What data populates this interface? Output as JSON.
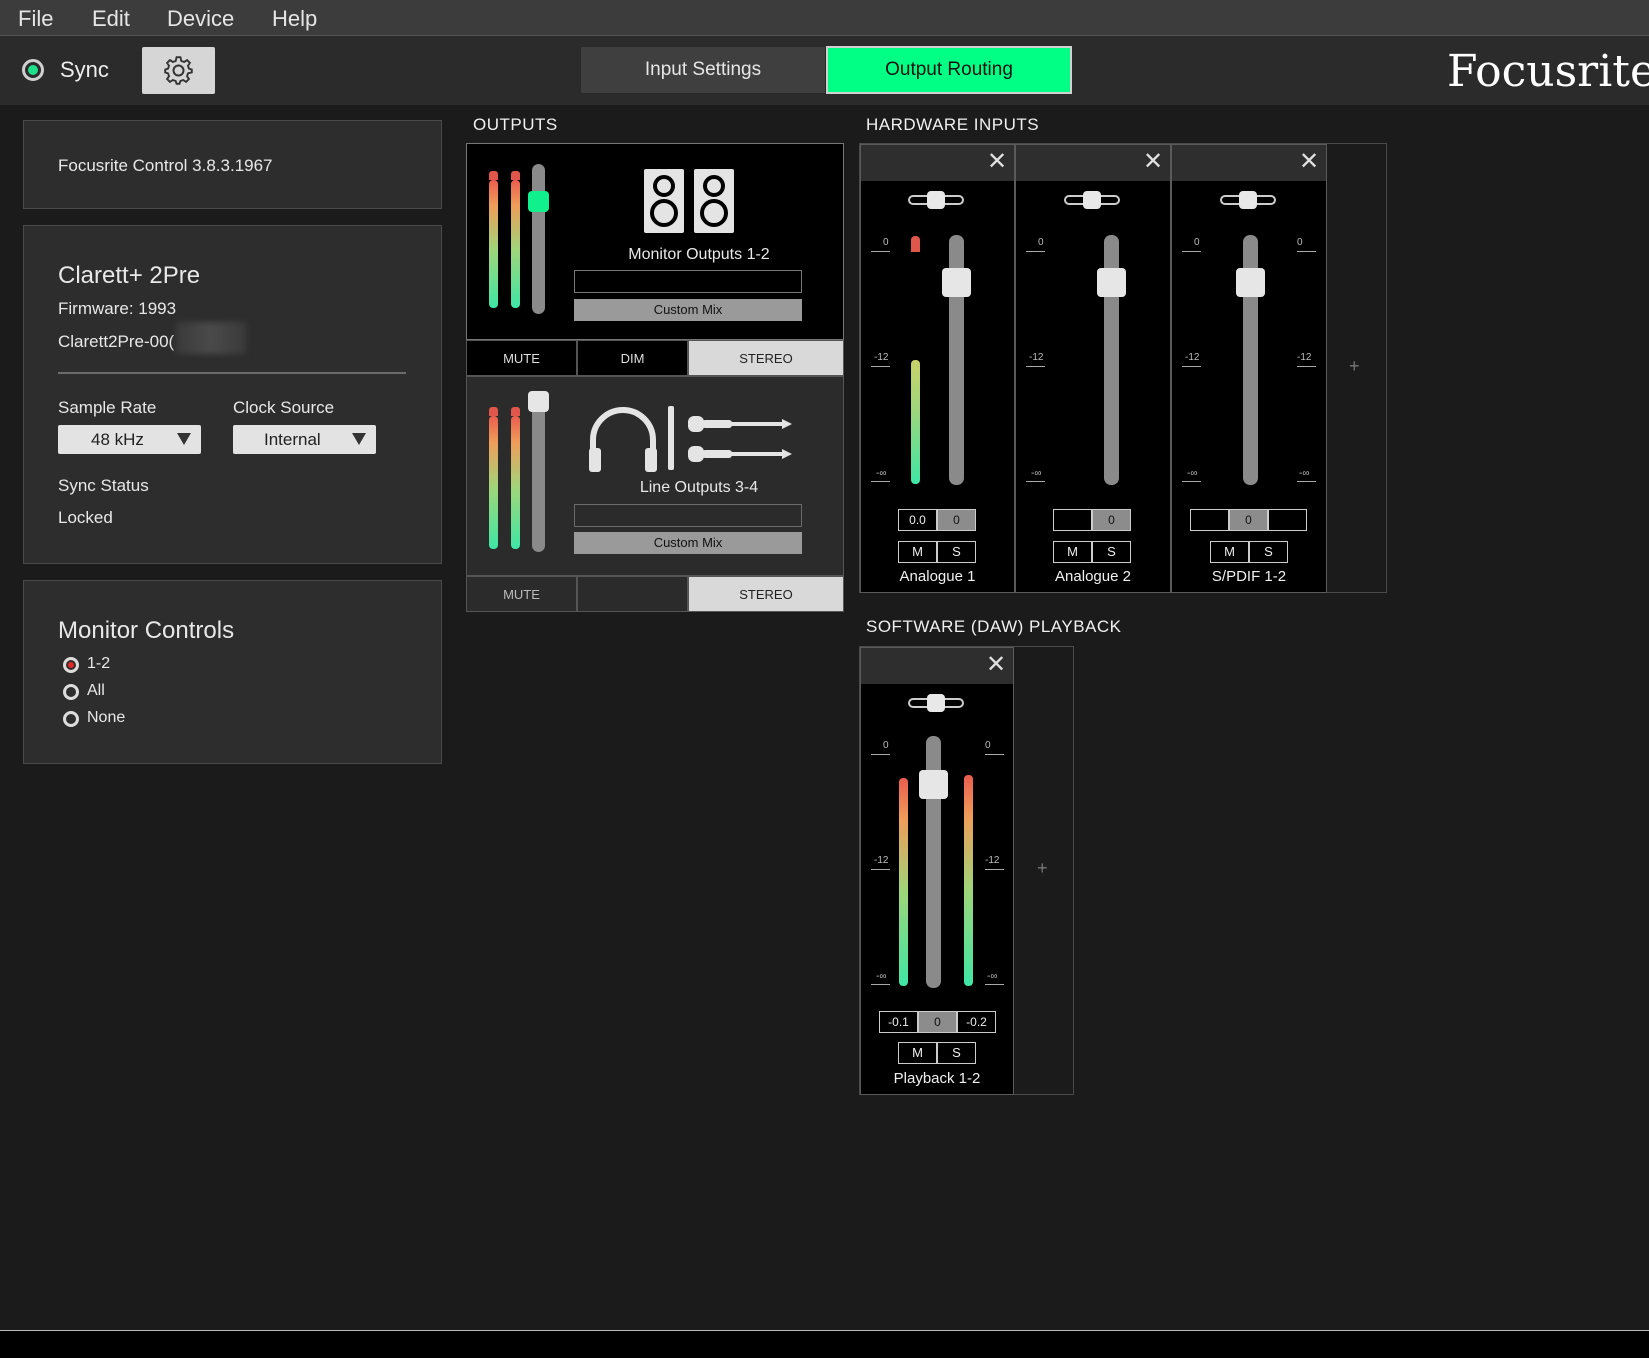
{
  "menu": [
    "File",
    "Edit",
    "Device",
    "Help"
  ],
  "topbar": {
    "sync_label": "Sync",
    "tabs": {
      "input": "Input Settings",
      "output": "Output Routing"
    },
    "brand": "Focusrite"
  },
  "colors": {
    "accent": "#00ff84",
    "background": "#1b1b1b",
    "panel": "#2d2d2d"
  },
  "version_panel": {
    "text": "Focusrite Control 3.8.3.1967"
  },
  "device_panel": {
    "name": "Clarett+ 2Pre",
    "firmware": "Firmware: 1993",
    "serial": "Clarett2Pre-00(",
    "sample_rate_label": "Sample Rate",
    "sample_rate_value": "48 kHz",
    "clock_source_label": "Clock Source",
    "clock_source_value": "Internal",
    "sync_status_label": "Sync Status",
    "sync_status_value": "Locked"
  },
  "monitor_controls": {
    "title": "Monitor Controls",
    "options": [
      "1-2",
      "All",
      "None"
    ],
    "selected": "1-2"
  },
  "outputs": {
    "title": "OUTPUTS",
    "monitor": {
      "name": "Monitor Outputs 1-2",
      "mix": "Custom Mix",
      "mute": "MUTE",
      "dim": "DIM",
      "stereo": "STEREO",
      "icon": "speakers-icon"
    },
    "line": {
      "name": "Line Outputs 3-4",
      "mix": "Custom Mix",
      "mute": "MUTE",
      "stereo": "STEREO",
      "icon": "headphones-jacks-icon"
    }
  },
  "hardware_inputs": {
    "title": "HARDWARE INPUTS",
    "strips": [
      {
        "name": "Analogue 1",
        "left": "0.0",
        "center": "0",
        "right": "",
        "m": "M",
        "s": "S"
      },
      {
        "name": "Analogue 2",
        "left": "",
        "center": "0",
        "right": "",
        "m": "M",
        "s": "S"
      },
      {
        "name": "S/PDIF 1-2",
        "left": "",
        "center": "0",
        "right": "",
        "m": "M",
        "s": "S"
      }
    ],
    "add": "+"
  },
  "daw_playback": {
    "title": "SOFTWARE (DAW) PLAYBACK",
    "strips": [
      {
        "name": "Playback 1-2",
        "left": "-0.1",
        "center": "0",
        "right": "-0.2",
        "m": "M",
        "s": "S"
      }
    ],
    "add": "+"
  },
  "scale": {
    "top": "0",
    "mid": "-12",
    "bottom": "-∞"
  },
  "close": "✕"
}
